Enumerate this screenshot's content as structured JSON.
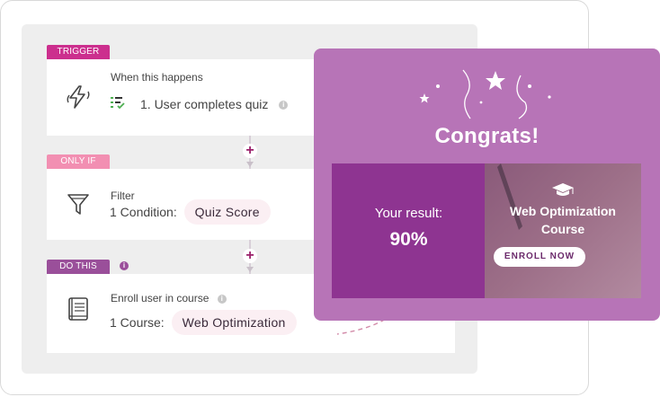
{
  "workflow": {
    "trigger": {
      "tag": "TRIGGER",
      "title": "When this happens",
      "detail": "1. User completes quiz"
    },
    "condition": {
      "tag": "ONLY IF",
      "title": "Filter",
      "detail_prefix": "1 Condition:",
      "pill": "Quiz Score"
    },
    "action": {
      "tag": "DO THIS",
      "title": "Enroll user in course",
      "detail_prefix": "1 Course:",
      "pill": "Web Optimization"
    },
    "add_symbol": "+",
    "info_symbol": "i"
  },
  "congrats": {
    "title": "Congrats!",
    "result_label": "Your result:",
    "result_value": "90%",
    "course_title_line1": "Web Optimization",
    "course_title_line2": "Course",
    "enroll_button": "ENROLL NOW"
  },
  "colors": {
    "trigger_tag": "#cc2f8e",
    "onlyif_tag": "#f28fb2",
    "dothis_tag": "#9a4f9a",
    "congrats_bg": "#b774b7",
    "result_bg": "#8e3491"
  }
}
